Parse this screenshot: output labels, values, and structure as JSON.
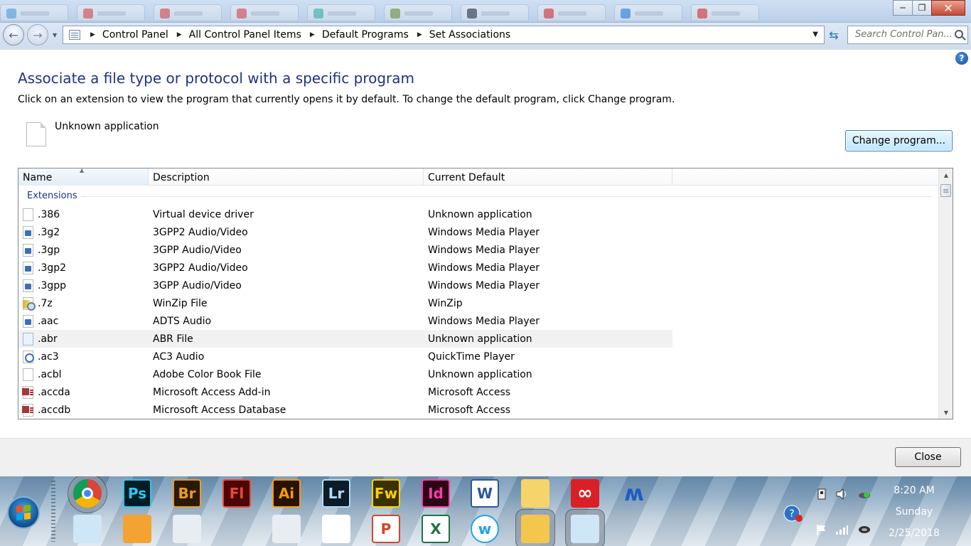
{
  "window": {
    "minimize_label": "─",
    "maximize_label": "❐",
    "close_label": "✕"
  },
  "address_bar": {
    "breadcrumbs": [
      "Control Panel",
      "All Control Panel Items",
      "Default Programs",
      "Set Associations"
    ],
    "search_placeholder": "Search Control Pan..."
  },
  "page": {
    "title": "Associate a file type or protocol with a specific program",
    "subtitle": "Click on an extension to view the program that currently opens it by default. To change the default program, click Change program.",
    "current_app": "Unknown application",
    "change_button": "Change program...",
    "help_label": "?"
  },
  "list": {
    "columns": [
      "Name",
      "Description",
      "Current Default"
    ],
    "group": "Extensions",
    "rows": [
      {
        "name": ".386",
        "description": "Virtual device driver",
        "default": "Unknown application",
        "icon": "blank-file-icon"
      },
      {
        "name": ".3g2",
        "description": "3GPP2 Audio/Video",
        "default": "Windows Media Player",
        "icon": "media-file-icon"
      },
      {
        "name": ".3gp",
        "description": "3GPP Audio/Video",
        "default": "Windows Media Player",
        "icon": "media-file-icon"
      },
      {
        "name": ".3gp2",
        "description": "3GPP2 Audio/Video",
        "default": "Windows Media Player",
        "icon": "media-file-icon"
      },
      {
        "name": ".3gpp",
        "description": "3GPP Audio/Video",
        "default": "Windows Media Player",
        "icon": "media-file-icon"
      },
      {
        "name": ".7z",
        "description": "WinZip File",
        "default": "WinZip",
        "icon": "zip-file-icon"
      },
      {
        "name": ".aac",
        "description": "ADTS Audio",
        "default": "Windows Media Player",
        "icon": "media-file-icon"
      },
      {
        "name": ".abr",
        "description": "ABR File",
        "default": "Unknown application",
        "icon": "abr-file-icon"
      },
      {
        "name": ".ac3",
        "description": "AC3 Audio",
        "default": "QuickTime Player",
        "icon": "quicktime-file-icon"
      },
      {
        "name": ".acbl",
        "description": "Adobe Color Book File",
        "default": "Unknown application",
        "icon": "blank-file-icon"
      },
      {
        "name": ".accda",
        "description": "Microsoft Access Add-in",
        "default": "Microsoft Access",
        "icon": "access-file-icon"
      },
      {
        "name": ".accdb",
        "description": "Microsoft Access Database",
        "default": "Microsoft Access",
        "icon": "access-file-icon"
      }
    ]
  },
  "footer": {
    "close_button": "Close"
  },
  "taskbar": {
    "apps_top": [
      {
        "label": "",
        "icon": "chrome-icon",
        "bg": "#ffffff"
      },
      {
        "label": "Ps",
        "icon": "photoshop-icon",
        "bg": "#001d26",
        "fg": "#31c5f0"
      },
      {
        "label": "Br",
        "icon": "bridge-icon",
        "bg": "#2a1a05",
        "fg": "#e89b2c"
      },
      {
        "label": "Fl",
        "icon": "flash-icon",
        "bg": "#4d0606",
        "fg": "#e64b3b"
      },
      {
        "label": "Ai",
        "icon": "illustrator-icon",
        "bg": "#261300",
        "fg": "#ff9a00"
      },
      {
        "label": "Lr",
        "icon": "lightroom-icon",
        "bg": "#0b1c28",
        "fg": "#b6dbf5"
      },
      {
        "label": "Fw",
        "icon": "fireworks-icon",
        "bg": "#3b3000",
        "fg": "#fdd200"
      },
      {
        "label": "Id",
        "icon": "indesign-icon",
        "bg": "#2a0617",
        "fg": "#ff3da4"
      },
      {
        "label": "W",
        "icon": "word-icon",
        "bg": "#ffffff",
        "fg": "#2b579a"
      },
      {
        "label": "",
        "icon": "file-explorer-icon",
        "bg": "#f5d46b"
      },
      {
        "label": "",
        "icon": "creative-cloud-icon",
        "bg": "#da1f26"
      },
      {
        "label": "",
        "icon": "malwarebytes-icon",
        "bg": "transparent"
      },
      {
        "label": "",
        "icon": "castle-icon",
        "bg": "transparent"
      },
      {
        "label": "",
        "icon": "scanner-icon",
        "bg": "transparent"
      }
    ],
    "apps_bottom": [
      {
        "label": "",
        "icon": "notepad-icon",
        "bg": "#cfe6f7"
      },
      {
        "label": "",
        "icon": "media-player-icon",
        "bg": "#f4a332"
      },
      {
        "label": "",
        "icon": "calculator-icon",
        "bg": "#e8edf2"
      },
      {
        "label": "",
        "icon": "windows-features-icon",
        "bg": "transparent"
      },
      {
        "label": "",
        "icon": "control-panel-icon",
        "bg": "#e8edf2"
      },
      {
        "label": "",
        "icon": "acrobat-icon",
        "bg": "#ffffff"
      },
      {
        "label": "P",
        "icon": "powerpoint-icon",
        "bg": "#ffffff",
        "fg": "#d24726"
      },
      {
        "label": "X",
        "icon": "excel-icon",
        "bg": "#ffffff",
        "fg": "#207245"
      },
      {
        "label": "w",
        "icon": "wps-icon",
        "bg": "#ffffff",
        "fg": "#20a4e8"
      },
      {
        "label": "",
        "icon": "winzip-icon",
        "bg": "#f4c64c"
      },
      {
        "label": "",
        "icon": "default-programs-icon",
        "bg": "#cfe6f7"
      }
    ],
    "clock": {
      "time": "8:20 AM",
      "day": "Sunday",
      "date": "2/25/2018"
    }
  }
}
